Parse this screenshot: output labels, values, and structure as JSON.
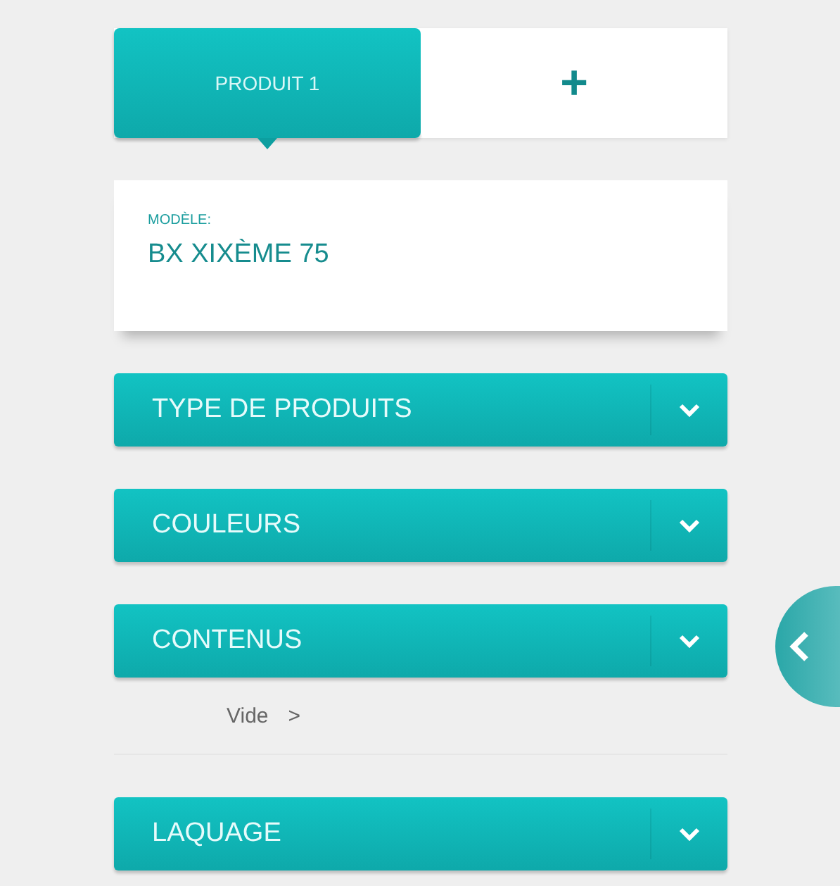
{
  "tabs": [
    {
      "kind": "product",
      "label": "PRODUIT 1",
      "selected": true
    },
    {
      "kind": "add",
      "label": "+",
      "selected": false
    }
  ],
  "model": {
    "label": "MODÈLE:",
    "value": "BX XIXÈME 75"
  },
  "sections": [
    {
      "title": "TYPE DE PRODUITS"
    },
    {
      "title": "COULEURS"
    },
    {
      "title": "CONTENUS",
      "entries": [
        {
          "label": "Vide",
          "arrow": ">"
        }
      ]
    },
    {
      "title": "LAQUAGE"
    }
  ]
}
